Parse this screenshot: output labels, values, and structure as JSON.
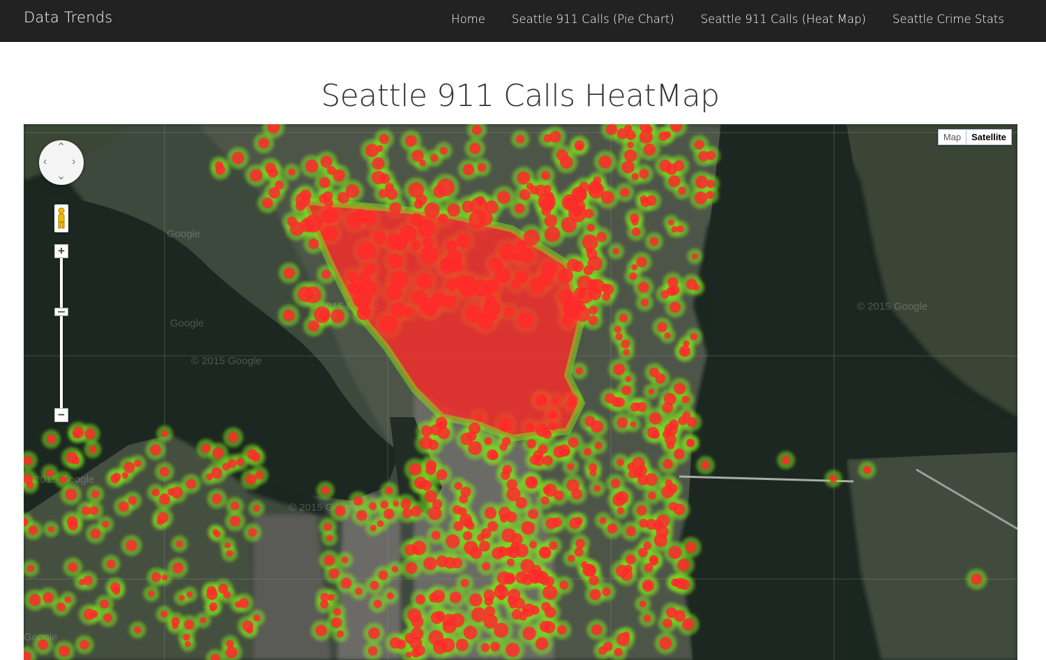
{
  "navbar": {
    "brand": "Data Trends",
    "links": [
      "Home",
      "Seattle 911 Calls (Pie Chart)",
      "Seattle 911 Calls (Heat Map)",
      "Seattle Crime Stats"
    ]
  },
  "page": {
    "title": "Seattle 911 Calls HeatMap"
  },
  "map": {
    "map_type_options": [
      "Map",
      "Satellite"
    ],
    "selected_map_type": "Satellite",
    "zoom_in_label": "+",
    "zoom_out_label": "−",
    "watermarks": [
      "Google",
      "© 2015 Google"
    ]
  },
  "colors": {
    "navbar_bg": "#222222",
    "heat_hot": "#ff2a2a",
    "heat_warm": "#7ddc1f",
    "water": "#1a2620"
  },
  "icons": [
    "pan-control-icon",
    "pegman-icon",
    "zoom-in-icon",
    "zoom-out-icon"
  ]
}
